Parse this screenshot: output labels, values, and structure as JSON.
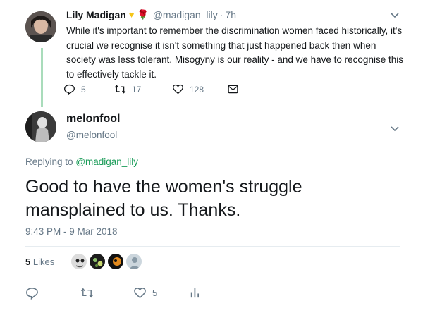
{
  "parent_tweet": {
    "name": "Lily Madigan",
    "handle": "@madigan_lily",
    "separator": "·",
    "time": "7h",
    "text": "While it's important to remember the discrimination women faced historically, it's crucial we recognise it isn't something that just happened back then when society was less tolerant. Misogyny is our reality - and we have to recognise this to effectively tackle it.",
    "emojis": [
      "yellow-heart",
      "rose"
    ],
    "reply_count": "5",
    "retweet_count": "17",
    "like_count": "128"
  },
  "main_tweet": {
    "name": "melonfool",
    "handle": "@melonfool",
    "replying_label": "Replying to",
    "replying_handle": "@madigan_lily",
    "text": "Good to have the women's struggle mansplained to us.  Thanks.",
    "timestamp": "9:43 PM - 9 Mar 2018",
    "likes_count": "5",
    "likes_label": "Likes",
    "like_action_count": "5"
  },
  "colors": {
    "accent_green": "#1b9c59",
    "thread_line": "#a9dcbb",
    "secondary_text": "#657786"
  }
}
